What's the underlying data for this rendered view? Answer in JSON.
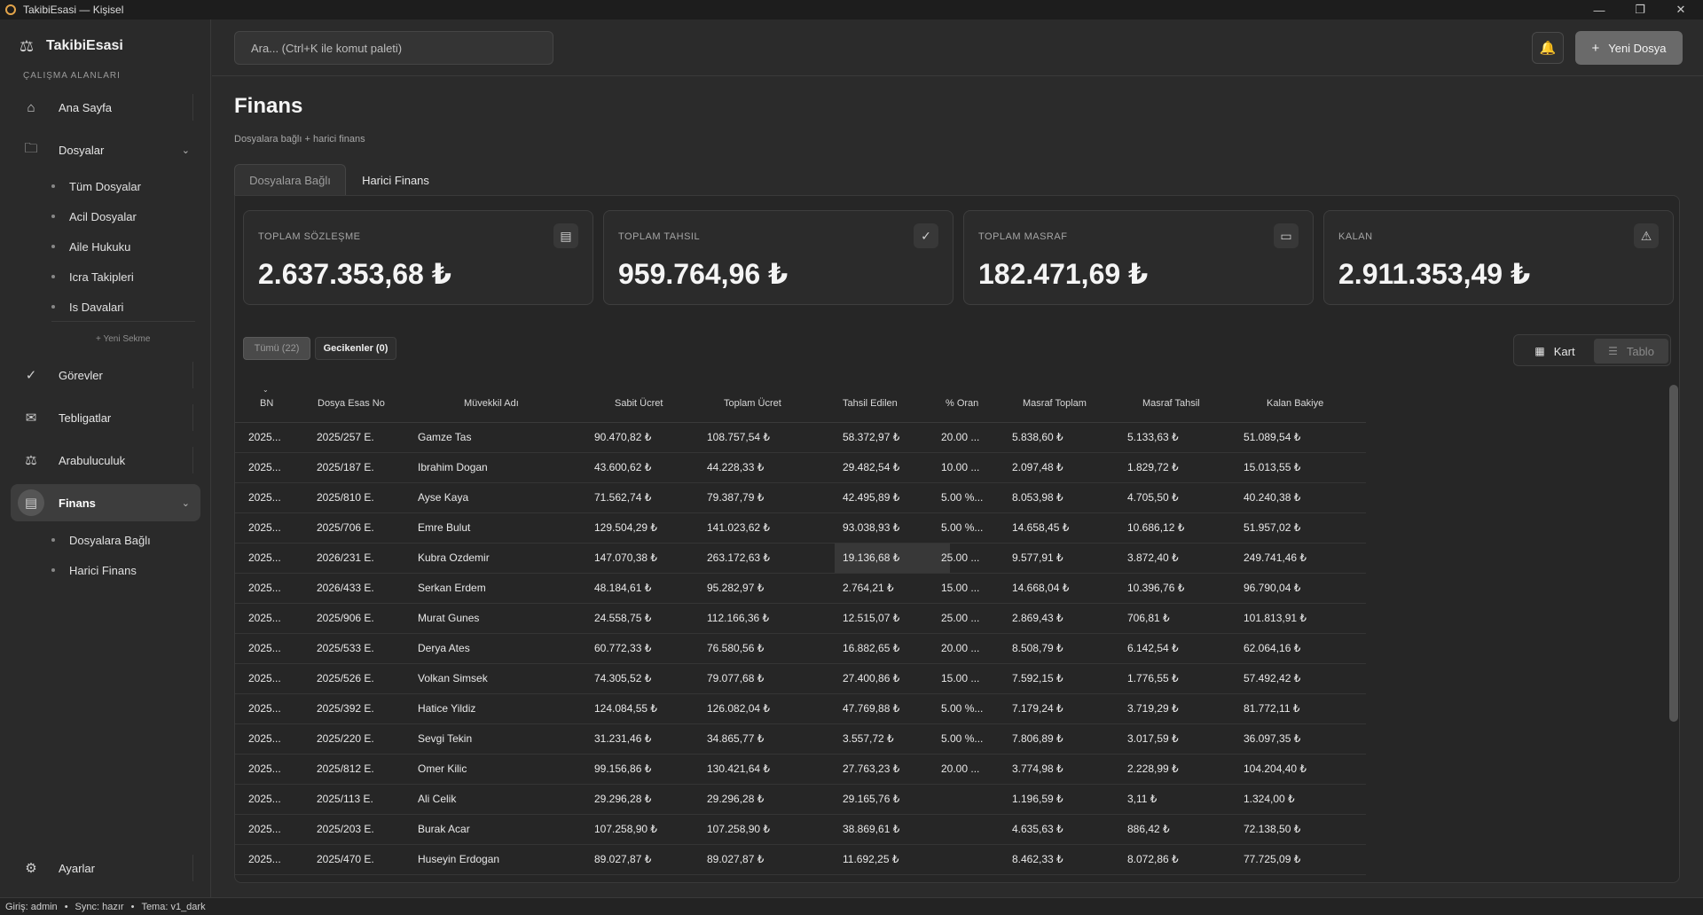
{
  "window": {
    "title": "TakibiEsasi — Kişisel"
  },
  "sidebar": {
    "brand": "TakibiEsasi",
    "section_label": "ÇALIŞMA ALANLARI",
    "items": {
      "home": "Ana Sayfa",
      "files": "Dosyalar",
      "tasks": "Görevler",
      "notifications": "Tebligatlar",
      "mediation": "Arabuluculuk",
      "finance": "Finans",
      "settings": "Ayarlar"
    },
    "file_subitems": [
      "Tüm Dosyalar",
      "Acil Dosyalar",
      "Aile Hukuku",
      "Icra Takipleri",
      "Is Davalari"
    ],
    "new_tab": "+ Yeni Sekme",
    "finance_subitems": [
      "Dosyalara Bağlı",
      "Harici Finans"
    ]
  },
  "topbar": {
    "search_placeholder": "Ara...   (Ctrl+K ile komut paleti)",
    "new_file": "Yeni Dosya"
  },
  "page": {
    "title": "Finans",
    "subtitle": "Dosyalara bağlı + harici finans",
    "tabs": [
      "Dosyalara Bağlı",
      "Harici Finans"
    ]
  },
  "stats": [
    {
      "label": "TOPLAM SÖZLEŞME",
      "value": "2.637.353,68 ₺",
      "icon": "wallet-icon"
    },
    {
      "label": "TOPLAM TAHSIL",
      "value": "959.764,96 ₺",
      "icon": "check-circle-icon"
    },
    {
      "label": "TOPLAM MASRAF",
      "value": "182.471,69 ₺",
      "icon": "credit-card-icon"
    },
    {
      "label": "KALAN",
      "value": "2.911.353,49 ₺",
      "icon": "warning-icon"
    }
  ],
  "filters": {
    "all": "Tümü (22)",
    "late": "Gecikenler (0)"
  },
  "view_toggle": {
    "card": "Kart",
    "table": "Tablo"
  },
  "table": {
    "headers": [
      "BN",
      "Dosya Esas No",
      "Müvekkil Adı",
      "Sabit Ücret",
      "Toplam Ücret",
      "Tahsil Edilen",
      "% Oran",
      "Masraf Toplam",
      "Masraf Tahsil",
      "Kalan Bakiye"
    ],
    "rows": [
      [
        "2025...",
        "2025/257 E.",
        "Gamze Tas",
        "90.470,82 ₺",
        "108.757,54 ₺",
        "58.372,97 ₺",
        "20.00 ...",
        "5.838,60 ₺",
        "5.133,63 ₺",
        "51.089,54 ₺"
      ],
      [
        "2025...",
        "2025/187 E.",
        "Ibrahim Dogan",
        "43.600,62 ₺",
        "44.228,33 ₺",
        "29.482,54 ₺",
        "10.00 ...",
        "2.097,48 ₺",
        "1.829,72 ₺",
        "15.013,55 ₺"
      ],
      [
        "2025...",
        "2025/810 E.",
        "Ayse Kaya",
        "71.562,74 ₺",
        "79.387,79 ₺",
        "42.495,89 ₺",
        "5.00 %...",
        "8.053,98 ₺",
        "4.705,50 ₺",
        "40.240,38 ₺"
      ],
      [
        "2025...",
        "2025/706 E.",
        "Emre Bulut",
        "129.504,29 ₺",
        "141.023,62 ₺",
        "93.038,93 ₺",
        "5.00 %...",
        "14.658,45 ₺",
        "10.686,12 ₺",
        "51.957,02 ₺"
      ],
      [
        "2025...",
        "2026/231 E.",
        "Kubra Ozdemir",
        "147.070,38 ₺",
        "263.172,63 ₺",
        "19.136,68 ₺",
        "25.00 ...",
        "9.577,91 ₺",
        "3.872,40 ₺",
        "249.741,46 ₺"
      ],
      [
        "2025...",
        "2026/433 E.",
        "Serkan Erdem",
        "48.184,61 ₺",
        "95.282,97 ₺",
        "2.764,21 ₺",
        "15.00 ...",
        "14.668,04 ₺",
        "10.396,76 ₺",
        "96.790,04 ₺"
      ],
      [
        "2025...",
        "2025/906 E.",
        "Murat Gunes",
        "24.558,75 ₺",
        "112.166,36 ₺",
        "12.515,07 ₺",
        "25.00 ...",
        "2.869,43 ₺",
        "706,81 ₺",
        "101.813,91 ₺"
      ],
      [
        "2025...",
        "2025/533 E.",
        "Derya Ates",
        "60.772,33 ₺",
        "76.580,56 ₺",
        "16.882,65 ₺",
        "20.00 ...",
        "8.508,79 ₺",
        "6.142,54 ₺",
        "62.064,16 ₺"
      ],
      [
        "2025...",
        "2025/526 E.",
        "Volkan Simsek",
        "74.305,52 ₺",
        "79.077,68 ₺",
        "27.400,86 ₺",
        "15.00 ...",
        "7.592,15 ₺",
        "1.776,55 ₺",
        "57.492,42 ₺"
      ],
      [
        "2025...",
        "2025/392 E.",
        "Hatice Yildiz",
        "124.084,55 ₺",
        "126.082,04 ₺",
        "47.769,88 ₺",
        "5.00 %...",
        "7.179,24 ₺",
        "3.719,29 ₺",
        "81.772,11 ₺"
      ],
      [
        "2025...",
        "2025/220 E.",
        "Sevgi Tekin",
        "31.231,46 ₺",
        "34.865,77 ₺",
        "3.557,72 ₺",
        "5.00 %...",
        "7.806,89 ₺",
        "3.017,59 ₺",
        "36.097,35 ₺"
      ],
      [
        "2025...",
        "2025/812 E.",
        "Omer Kilic",
        "99.156,86 ₺",
        "130.421,64 ₺",
        "27.763,23 ₺",
        "20.00 ...",
        "3.774,98 ₺",
        "2.228,99 ₺",
        "104.204,40 ₺"
      ],
      [
        "2025...",
        "2025/113 E.",
        "Ali Celik",
        "29.296,28 ₺",
        "29.296,28 ₺",
        "29.165,76 ₺",
        "",
        "1.196,59 ₺",
        "3,11 ₺",
        "1.324,00 ₺"
      ],
      [
        "2025...",
        "2025/203 E.",
        "Burak Acar",
        "107.258,90 ₺",
        "107.258,90 ₺",
        "38.869,61 ₺",
        "",
        "4.635,63 ₺",
        "886,42 ₺",
        "72.138,50 ₺"
      ],
      [
        "2025...",
        "2025/470 E.",
        "Huseyin Erdogan",
        "89.027,87 ₺",
        "89.027,87 ₺",
        "11.692,25 ₺",
        "",
        "8.462,33 ₺",
        "8.072,86 ₺",
        "77.725,09 ₺"
      ]
    ]
  },
  "statusbar": {
    "login": "Giriş: admin",
    "sync": "Sync: hazır",
    "theme": "Tema: v1_dark"
  }
}
